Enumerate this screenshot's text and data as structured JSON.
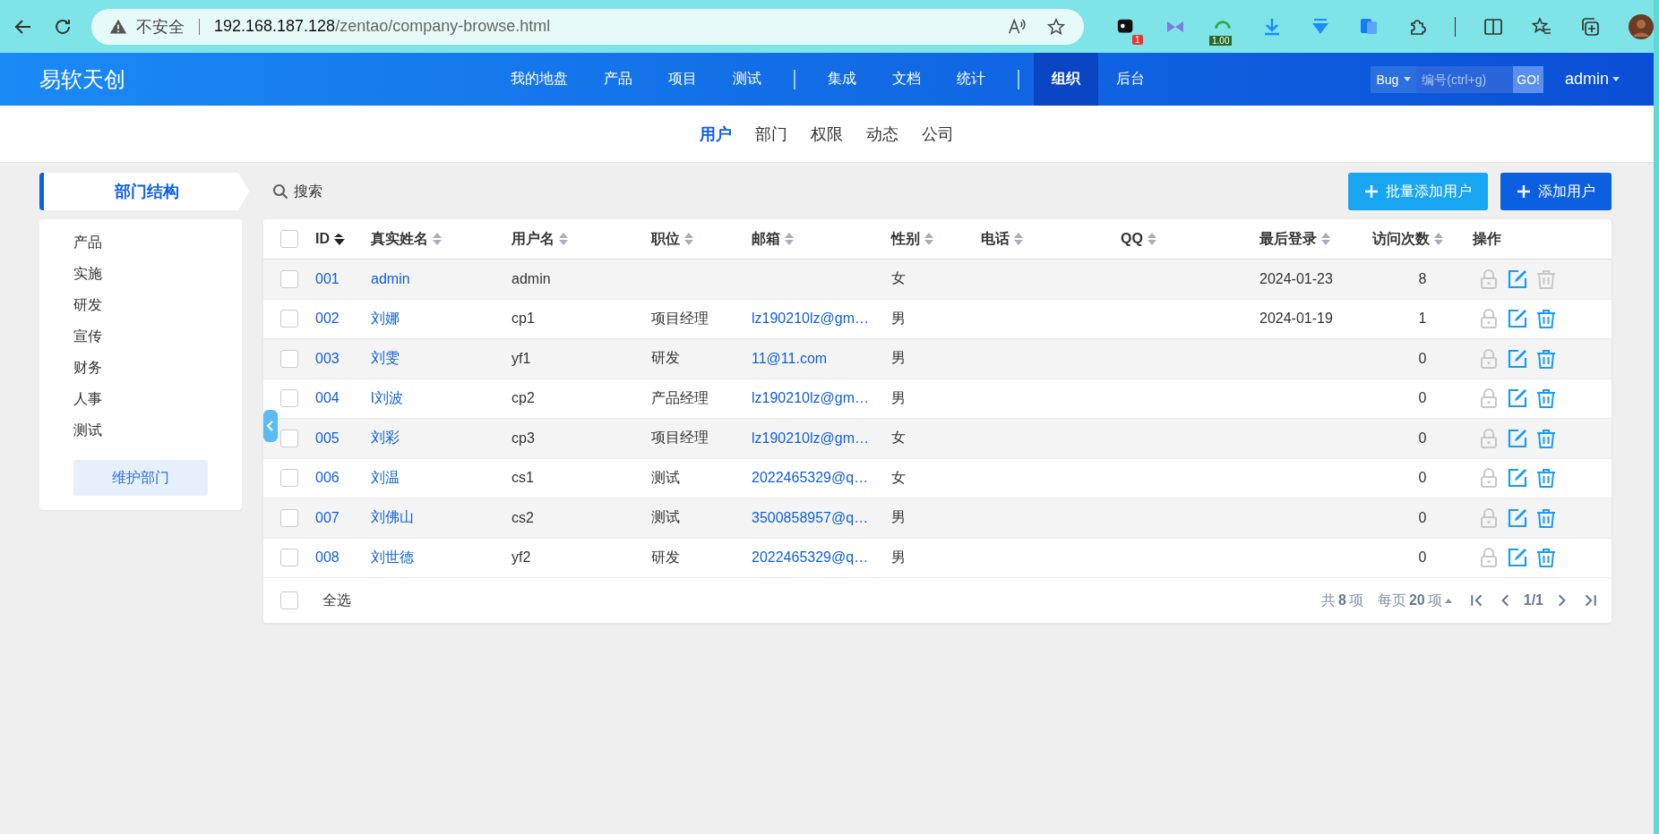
{
  "browser": {
    "security": "不安全",
    "url_host": "192.168.187.128",
    "url_path": "/zentao/company-browse.html",
    "extension_badge": "1",
    "extension_label": "1.00"
  },
  "header": {
    "logo": "易软天创",
    "nav_groups": [
      {
        "items": [
          {
            "label": "我的地盘",
            "selected": false
          },
          {
            "label": "产品",
            "selected": false
          },
          {
            "label": "项目",
            "selected": false
          },
          {
            "label": "测试",
            "selected": false
          }
        ]
      },
      {
        "items": [
          {
            "label": "集成",
            "selected": false
          },
          {
            "label": "文档",
            "selected": false
          },
          {
            "label": "统计",
            "selected": false
          }
        ]
      },
      {
        "items": [
          {
            "label": "组织",
            "selected": true
          },
          {
            "label": "后台",
            "selected": false
          }
        ]
      }
    ],
    "search": {
      "type": "Bug",
      "placeholder": "编号(ctrl+g)",
      "go": "GO!"
    },
    "user": "admin"
  },
  "subnav": [
    {
      "label": "用户",
      "selected": true
    },
    {
      "label": "部门",
      "selected": false
    },
    {
      "label": "权限",
      "selected": false
    },
    {
      "label": "动态",
      "selected": false
    },
    {
      "label": "公司",
      "selected": false
    }
  ],
  "sidebar": {
    "title": "部门结构",
    "items": [
      "产品",
      "实施",
      "研发",
      "宣传",
      "财务",
      "人事",
      "测试"
    ],
    "button": "维护部门"
  },
  "toolbar": {
    "search": "搜索",
    "buttons": [
      {
        "label": "批量添加用户",
        "kind": "secondary"
      },
      {
        "label": "添加用户",
        "kind": "primary"
      }
    ]
  },
  "table": {
    "header_checked": false,
    "columns": [
      {
        "label": "ID",
        "sortable": true,
        "sorted": true
      },
      {
        "label": "真实姓名",
        "sortable": true,
        "sorted": false
      },
      {
        "label": "用户名",
        "sortable": true,
        "sorted": false
      },
      {
        "label": "职位",
        "sortable": true,
        "sorted": false
      },
      {
        "label": "邮箱",
        "sortable": true,
        "sorted": false
      },
      {
        "label": "性别",
        "sortable": true,
        "sorted": false
      },
      {
        "label": "电话",
        "sortable": true,
        "sorted": false
      },
      {
        "label": "QQ",
        "sortable": true,
        "sorted": false
      },
      {
        "label": "最后登录",
        "sortable": true,
        "sorted": false
      },
      {
        "label": "访问次数",
        "sortable": true,
        "sorted": false
      },
      {
        "label": "操作",
        "sortable": false
      }
    ],
    "rows": [
      {
        "checked": false,
        "id": "001",
        "realname": "admin",
        "username": "admin",
        "position": "",
        "email": "",
        "gender": "女",
        "phone": "",
        "qq": "",
        "last_login": "2024-01-23",
        "visits": "8",
        "delete_disabled": true
      },
      {
        "checked": false,
        "id": "002",
        "realname": "刘娜",
        "username": "cp1",
        "position": "项目经理",
        "email": "lz190210lz@gm…",
        "gender": "男",
        "phone": "",
        "qq": "",
        "last_login": "2024-01-19",
        "visits": "1",
        "delete_disabled": false
      },
      {
        "checked": false,
        "id": "003",
        "realname": "刘雯",
        "username": "yf1",
        "position": "研发",
        "email": "11@11.com",
        "gender": "男",
        "phone": "",
        "qq": "",
        "last_login": "",
        "visits": "0",
        "delete_disabled": false
      },
      {
        "checked": false,
        "id": "004",
        "realname": "l刘波",
        "username": "cp2",
        "position": "产品经理",
        "email": "lz190210lz@gm…",
        "gender": "男",
        "phone": "",
        "qq": "",
        "last_login": "",
        "visits": "0",
        "delete_disabled": false
      },
      {
        "checked": false,
        "id": "005",
        "realname": "刘彩",
        "username": "cp3",
        "position": "项目经理",
        "email": "lz190210lz@gm…",
        "gender": "女",
        "phone": "",
        "qq": "",
        "last_login": "",
        "visits": "0",
        "delete_disabled": false
      },
      {
        "checked": false,
        "id": "006",
        "realname": "刘温",
        "username": "cs1",
        "position": "测试",
        "email": "2022465329@q…",
        "gender": "女",
        "phone": "",
        "qq": "",
        "last_login": "",
        "visits": "0",
        "delete_disabled": false
      },
      {
        "checked": false,
        "id": "007",
        "realname": "刘佛山",
        "username": "cs2",
        "position": "测试",
        "email": "3500858957@q…",
        "gender": "男",
        "phone": "",
        "qq": "",
        "last_login": "",
        "visits": "0",
        "delete_disabled": false
      },
      {
        "checked": false,
        "id": "008",
        "realname": "刘世德",
        "username": "yf2",
        "position": "研发",
        "email": "2022465329@q…",
        "gender": "男",
        "phone": "",
        "qq": "",
        "last_login": "",
        "visits": "0",
        "delete_disabled": false
      }
    ],
    "footer": {
      "select_all": "全选",
      "select_all_checked": false,
      "total_pre": "共",
      "total": "8",
      "total_post": "项",
      "per_page_pre": "每页",
      "per_page": "20",
      "per_page_post": "项",
      "page": "1/1"
    }
  }
}
